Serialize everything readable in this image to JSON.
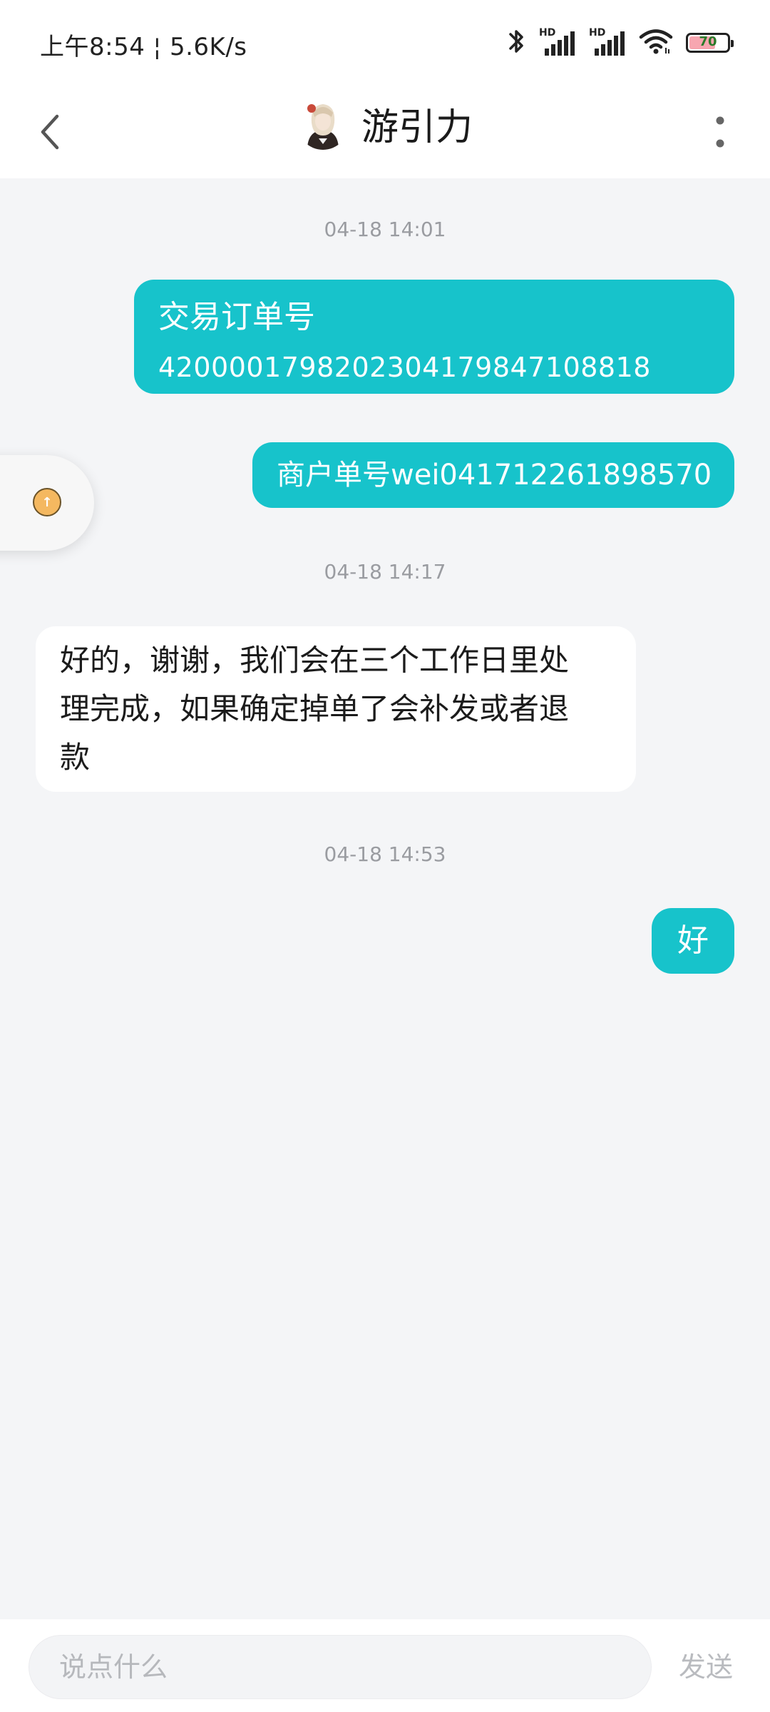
{
  "status_bar": {
    "time": "上午8:54",
    "separator": "¦",
    "speed": "5.6K/s",
    "signal_label": "HD",
    "battery_percent": "70",
    "battery_level": 0.7,
    "icons": [
      "bluetooth-icon",
      "signal-hd-icon",
      "signal-hd-icon",
      "wifi-icon",
      "battery-icon"
    ]
  },
  "header": {
    "title": "游引力",
    "back_icon": "chevron-left-icon",
    "more_icon": "more-vertical-icon"
  },
  "messages": [
    {
      "type": "timestamp",
      "text": "04-18 14:01"
    },
    {
      "type": "outgoing",
      "line1": "交易订单号",
      "line2": "4200001798202304179847108818"
    },
    {
      "type": "outgoing",
      "text": "商户单号wei041712261898570"
    },
    {
      "type": "timestamp",
      "text": "04-18 14:17"
    },
    {
      "type": "incoming",
      "lines": [
        "好的，谢谢，我们会在三个工作日里处",
        "理完成，如果确定掉单了会补发或者退",
        "款"
      ]
    },
    {
      "type": "timestamp",
      "text": "04-18 14:53"
    },
    {
      "type": "outgoing",
      "text": "好"
    }
  ],
  "input": {
    "placeholder": "说点什么",
    "send_label": "发送"
  },
  "colors": {
    "accent": "#17c3cb",
    "background": "#f4f5f7",
    "timestamp": "#9a9ca1",
    "send_disabled": "#b9bbbf"
  }
}
